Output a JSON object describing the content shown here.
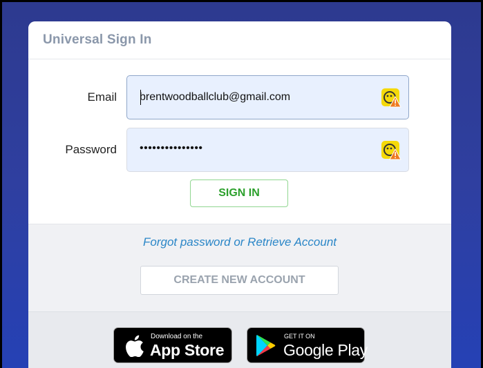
{
  "card": {
    "title": "Universal Sign In"
  },
  "form": {
    "email_label": "Email",
    "email_value": "brentwoodballclub@gmail.com",
    "password_label": "Password",
    "password_value": "•••••••••••••••",
    "signin_label": "SIGN IN"
  },
  "secondary": {
    "forgot_label": "Forgot password or Retrieve Account",
    "create_label": "CREATE NEW ACCOUNT"
  },
  "stores": {
    "apple_small": "Download on the",
    "apple_big": "App Store",
    "google_small": "GET IT ON",
    "google_big": "Google Play"
  },
  "icons": {
    "field_warning": "password-manager-warning-icon",
    "apple": "apple-logo-icon",
    "google_play": "google-play-logo-icon"
  },
  "colors": {
    "signin_green": "#2ca02c",
    "link_blue": "#2a86c7",
    "field_bg": "#e8f0fe",
    "warn_yellow": "#f5d90a",
    "warn_orange": "#ee7b1f"
  }
}
